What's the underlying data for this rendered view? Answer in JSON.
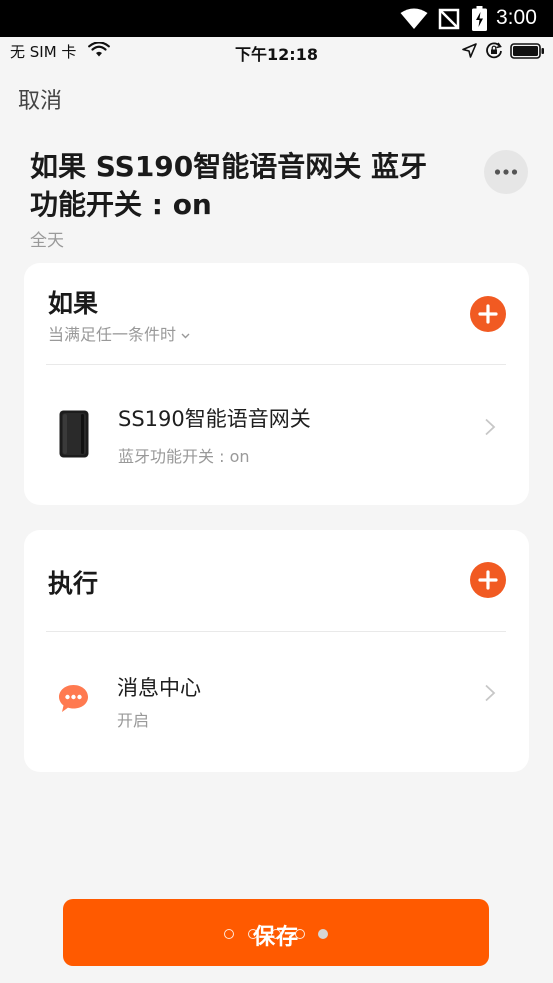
{
  "system_status_bar": {
    "time": "3:00",
    "icons": [
      "wifi-icon",
      "no-signal-icon",
      "battery-charging-icon"
    ]
  },
  "ios_status_bar": {
    "carrier": "无 SIM 卡",
    "time": "下午12:18",
    "icons": [
      "wifi-icon",
      "location-arrow-icon",
      "orientation-lock-icon",
      "battery-icon"
    ]
  },
  "nav": {
    "cancel_label": "取消",
    "more_icon": "more-icon"
  },
  "scene": {
    "title_lines": [
      "如果 SS190智能语音网关 蓝牙",
      "功能开关 : on"
    ],
    "schedule": "全天"
  },
  "condition_section": {
    "heading": "如果",
    "match_mode": "当满足任一条件时",
    "add_icon": "plus-icon",
    "items": [
      {
        "name": "SS190智能语音网关",
        "detail": "蓝牙功能开关 : on",
        "icon": "smart-gateway-icon"
      }
    ]
  },
  "action_section": {
    "heading": "执行",
    "add_icon": "plus-icon",
    "items": [
      {
        "name": "消息中心",
        "detail": "开启",
        "icon": "message-center-icon"
      }
    ]
  },
  "save_button": {
    "label": "保存"
  },
  "page_indicator": {
    "dot_count": 5,
    "active_index": 4
  },
  "colors": {
    "accent": "#ff5a00",
    "add_button": "#f15a22",
    "background": "#f5f5f5",
    "card": "#ffffff",
    "text_primary": "#1e1e1e",
    "text_secondary": "#999999",
    "message_icon": "#ff7a50"
  }
}
